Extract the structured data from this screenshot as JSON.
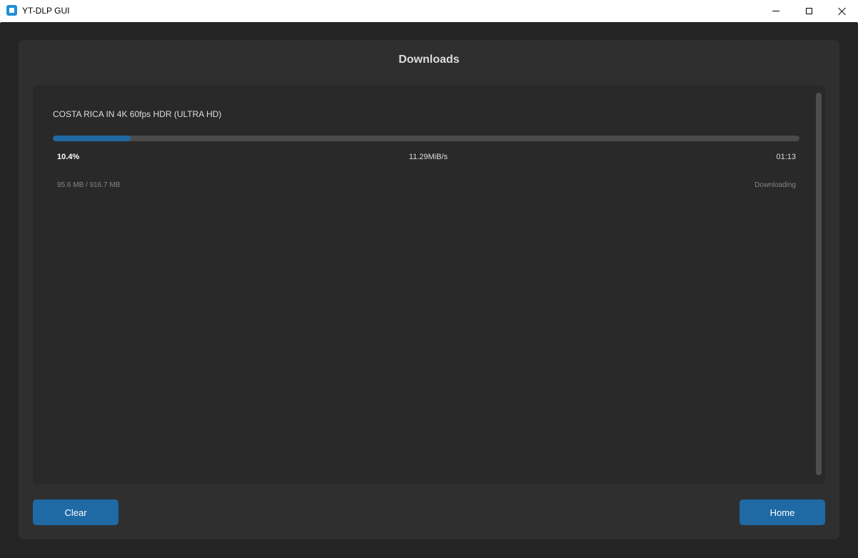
{
  "window": {
    "title": "YT-DLP GUI",
    "accent_color": "#1f6aa5",
    "icon": "app-icon"
  },
  "page": {
    "heading": "Downloads"
  },
  "downloads": [
    {
      "title": "COSTA RICA IN 4K 60fps HDR (ULTRA HD)",
      "progress": 0.104,
      "percent_label": "10.4%",
      "speed": "11.29MiB/s",
      "eta": "01:13",
      "size": "95.6 MB / 916.7 MB",
      "status": "Downloading"
    }
  ],
  "buttons": {
    "clear": "Clear",
    "home": "Home"
  }
}
